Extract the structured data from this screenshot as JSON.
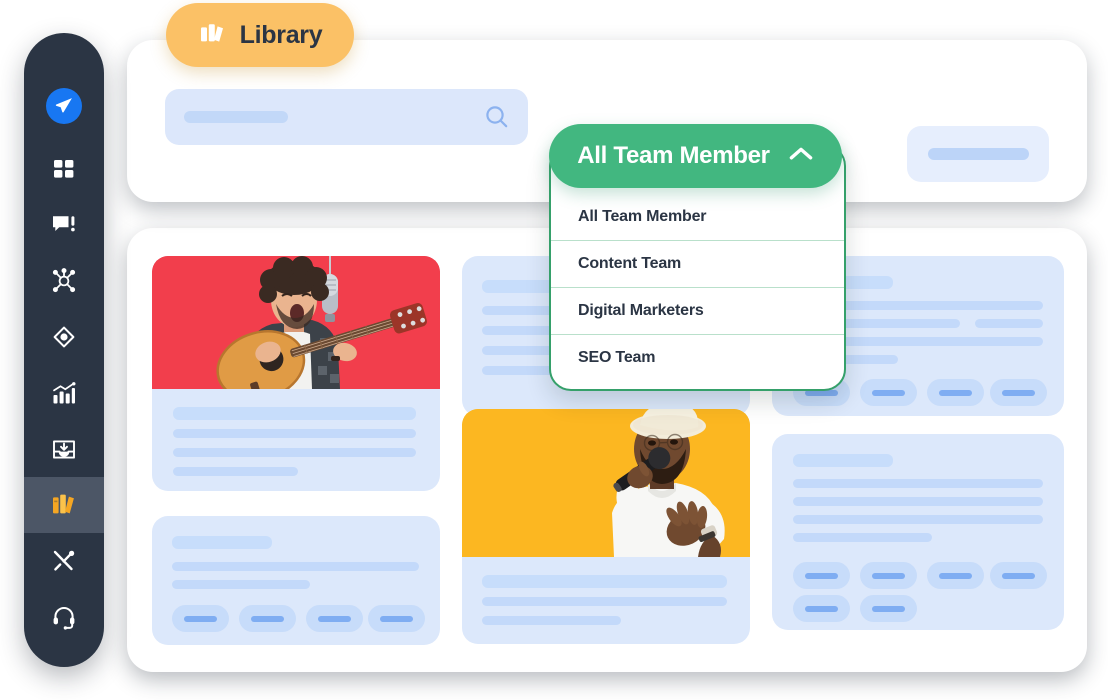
{
  "window": {
    "title": "Library",
    "background": "#ffffff"
  },
  "colors": {
    "sidebar_bg": "#2b3544",
    "sidebar_active_bg": "#4c5666",
    "accent_orange": "#fbc166",
    "accent_green": "#42b780",
    "dropdown_border": "#35a06a",
    "skeleton_card_bg": "#dce8fb",
    "skeleton_line": "#c3d9fa",
    "skeleton_pill": "#c7dcfa",
    "skeleton_pill_bar": "#7fadf2",
    "photo_red": "#f23e4c",
    "photo_gold": "#fcb721",
    "send_icon_badge": "#1877f2"
  },
  "sidebar": {
    "items": [
      {
        "name": "send-icon",
        "label": "Send",
        "active": false,
        "highlighted": true
      },
      {
        "name": "dashboard-icon",
        "label": "Dashboard",
        "active": false,
        "highlighted": false
      },
      {
        "name": "comment-alert-icon",
        "label": "Messages",
        "active": false,
        "highlighted": false
      },
      {
        "name": "network-icon",
        "label": "Network",
        "active": false,
        "highlighted": false
      },
      {
        "name": "diamond-icon",
        "label": "Campaigns",
        "active": false,
        "highlighted": false
      },
      {
        "name": "analytics-icon",
        "label": "Analytics",
        "active": false,
        "highlighted": false
      },
      {
        "name": "inbox-download-icon",
        "label": "Inbox",
        "active": false,
        "highlighted": false
      },
      {
        "name": "books-icon",
        "label": "Library",
        "active": true,
        "highlighted": false
      },
      {
        "name": "tools-icon",
        "label": "Tools",
        "active": false,
        "highlighted": false
      },
      {
        "name": "headset-icon",
        "label": "Support",
        "active": false,
        "highlighted": false
      }
    ]
  },
  "library_tab": {
    "label": "Library",
    "icon": "books-icon"
  },
  "header": {
    "search": {
      "placeholder": "",
      "value": "",
      "icon": "search-icon"
    },
    "right_chip": {
      "label": ""
    }
  },
  "dropdown": {
    "selected": "All Team Member",
    "expanded": true,
    "chevron_icon": "chevron-up-icon",
    "options": [
      "All Team Member",
      "Content Team",
      "Digital Marketers",
      "SEO Team"
    ]
  },
  "content": {
    "cards": [
      {
        "id": "card-guitarist",
        "photo": "guitarist-on-red-background",
        "photo_color": "#f23e4c",
        "lines": 4,
        "pills": 0
      },
      {
        "id": "card-left-tags",
        "photo": null,
        "lines": 3,
        "pills": 4
      },
      {
        "id": "card-middle-top",
        "photo": null,
        "lines": 5,
        "pills": 0
      },
      {
        "id": "card-singer",
        "photo": "singer-with-microphone-on-yellow-background",
        "photo_color": "#fcb721",
        "lines": 3,
        "pills": 0
      },
      {
        "id": "card-right-top",
        "photo": null,
        "lines": 5,
        "pills": 4
      },
      {
        "id": "card-right-bottom",
        "photo": null,
        "lines": 5,
        "pills": 6
      }
    ]
  }
}
